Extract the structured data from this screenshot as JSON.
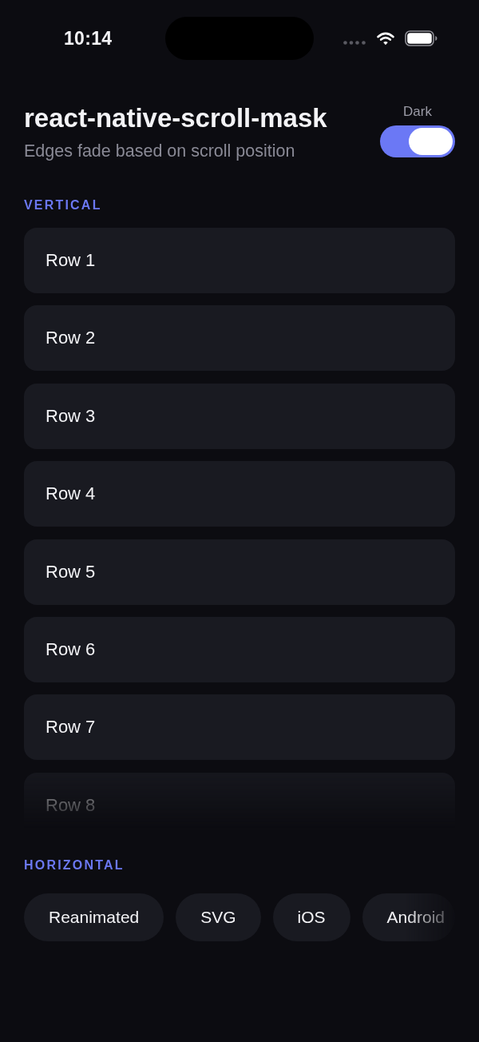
{
  "status_bar": {
    "time": "10:14"
  },
  "header": {
    "title": "react-native-scroll-mask",
    "subtitle": "Edges fade based on scroll position",
    "toggle": {
      "label": "Dark",
      "on": true
    }
  },
  "vertical": {
    "label": "VERTICAL",
    "rows": [
      "Row 1",
      "Row 2",
      "Row 3",
      "Row 4",
      "Row 5",
      "Row 6",
      "Row 7",
      "Row 8"
    ]
  },
  "horizontal": {
    "label": "HORIZONTAL",
    "chips": [
      "Reanimated",
      "SVG",
      "iOS",
      "Android"
    ]
  }
}
